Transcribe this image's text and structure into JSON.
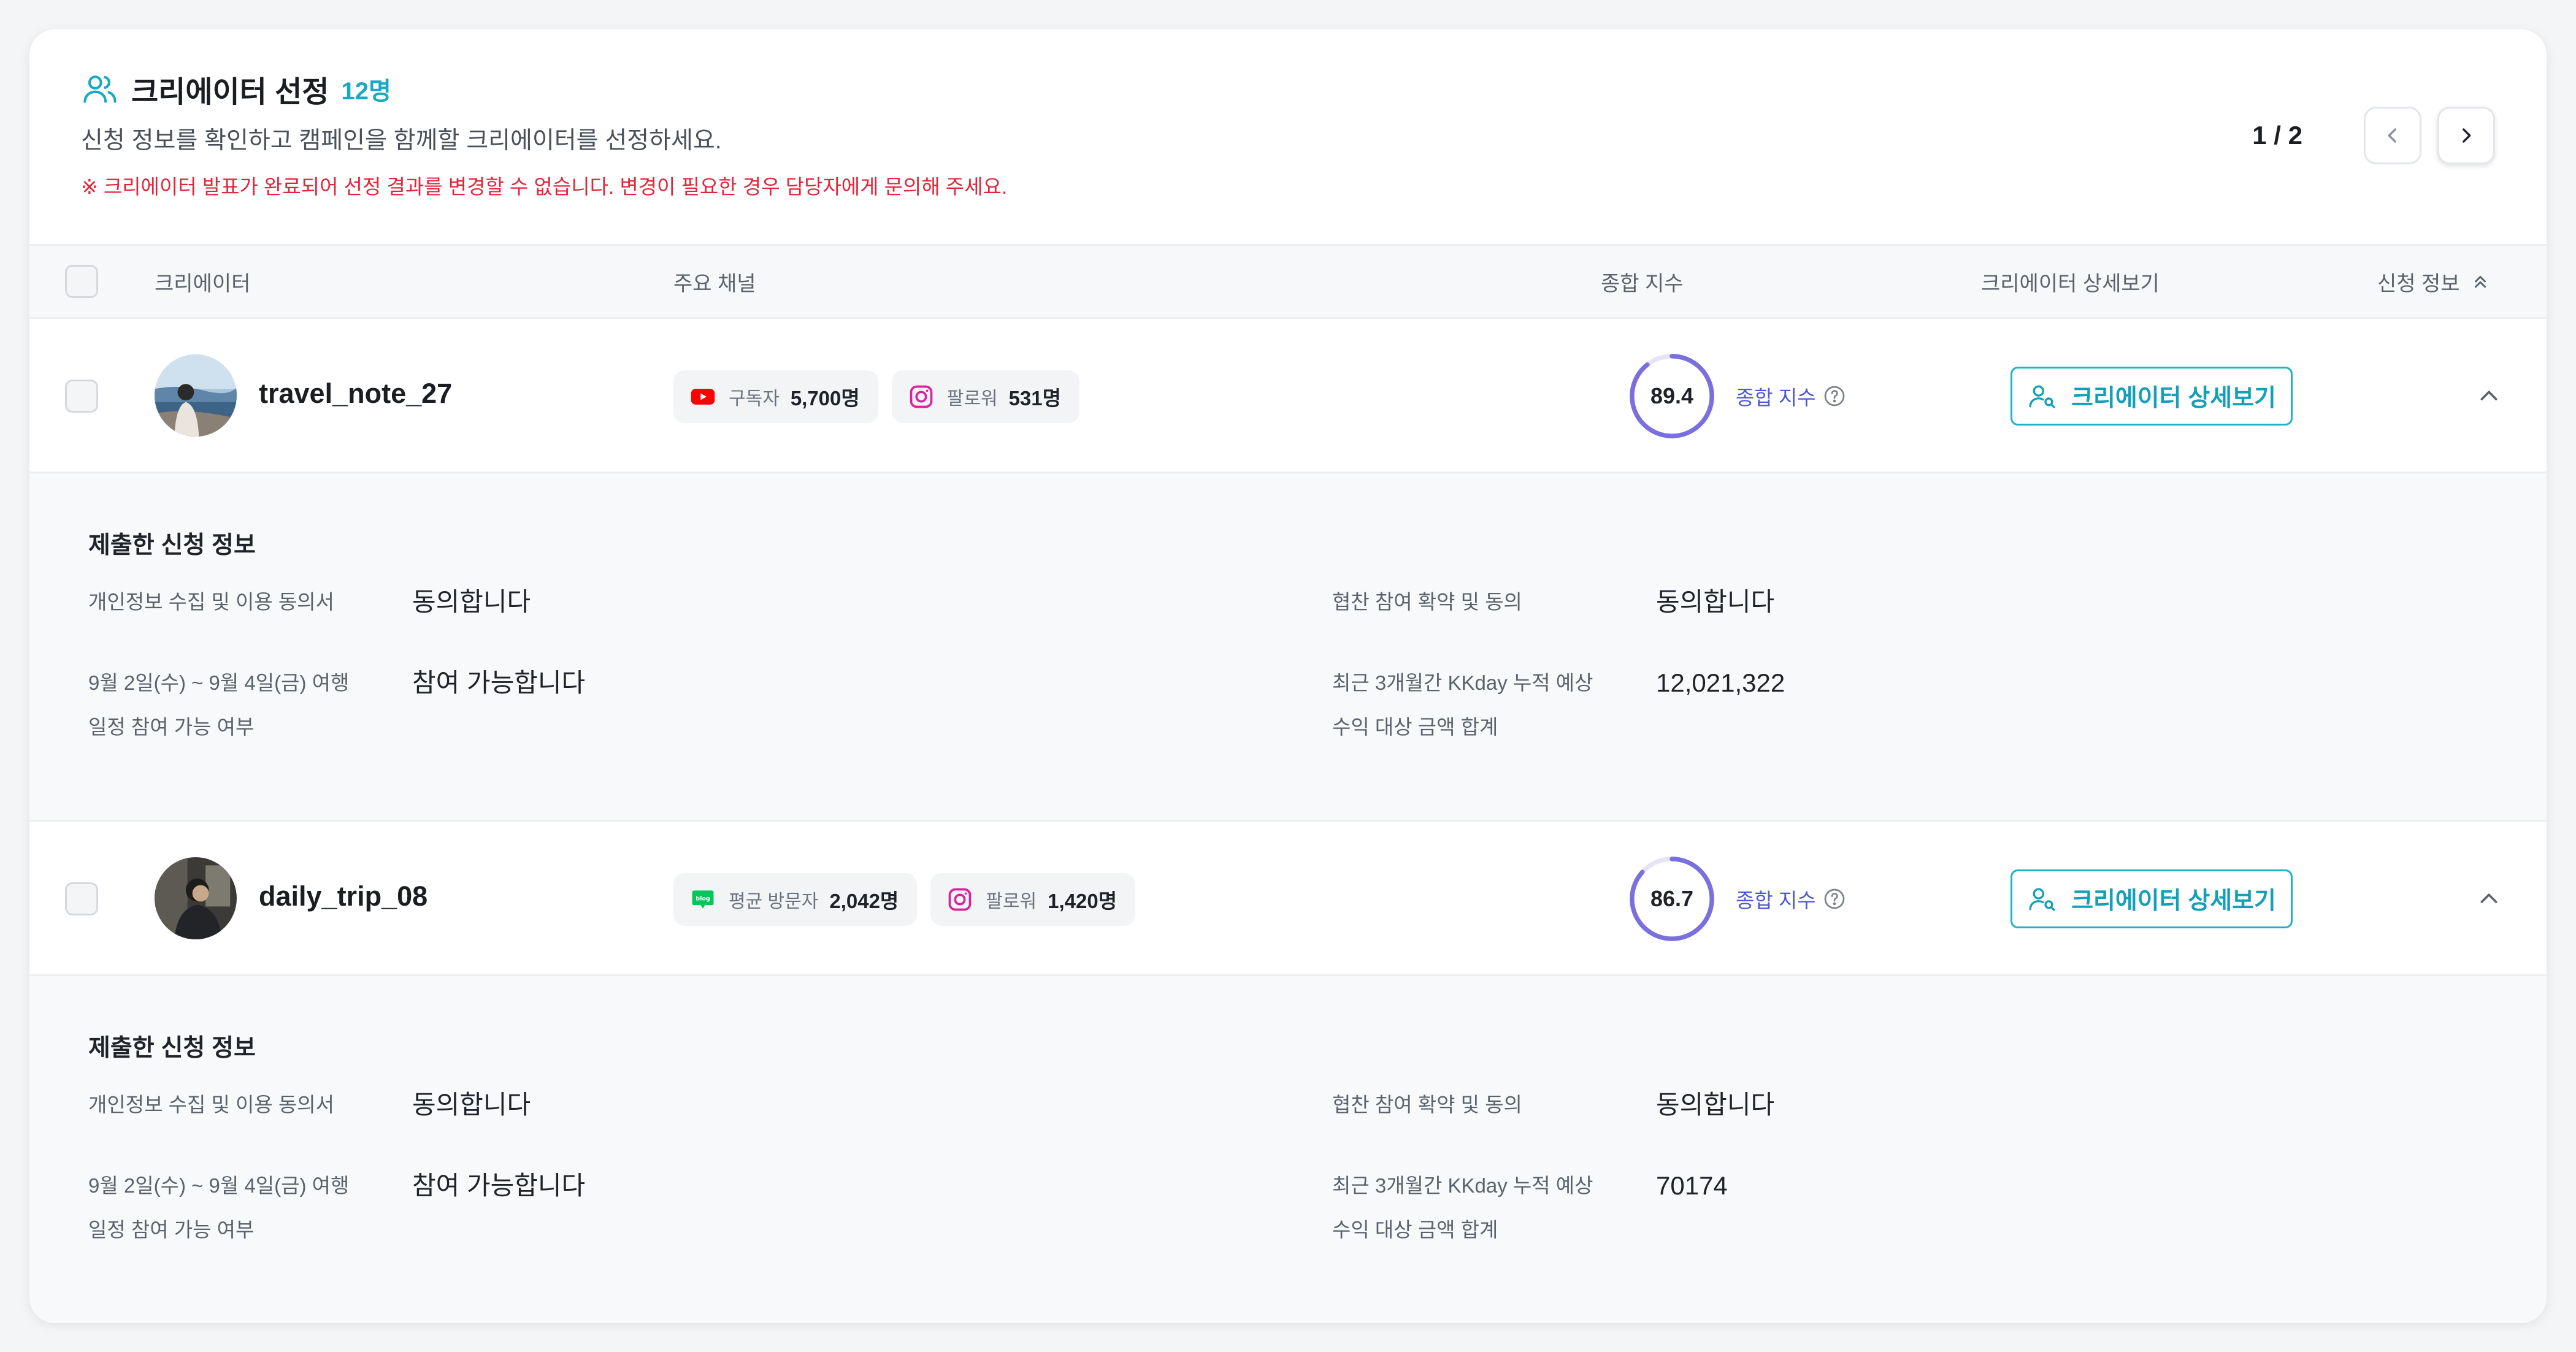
{
  "header": {
    "title": "크리에이터 선정",
    "count": "12명",
    "subtitle": "신청 정보를 확인하고 캠페인을 함께할 크리에이터를 선정하세요.",
    "notice": "※ 크리에이터 발표가 완료되어 선정 결과를 변경할 수 없습니다. 변경이 필요한 경우 담당자에게 문의해 주세요.",
    "page": "1 / 2"
  },
  "columns": {
    "creator": "크리에이터",
    "channel": "주요 채널",
    "score": "종합 지수",
    "detail": "크리에이터 상세보기",
    "apply": "신청 정보"
  },
  "rows": [
    {
      "handle": "travel_note_27",
      "channels": [
        {
          "icon": "youtube-icon",
          "label": "구독자",
          "value": "5,700명"
        },
        {
          "icon": "instagram-icon",
          "label": "팔로워",
          "value": "531명"
        }
      ],
      "score": 89.4,
      "score_text": "89.4",
      "score_label": "종합 지수",
      "detail_button": "크리에이터 상세보기",
      "panel": {
        "title": "제출한 신청 정보",
        "f1_label": "개인정보 수집 및 이용 동의서",
        "f1_value": "동의합니다",
        "f2_label": "협찬 참여 확약 및 동의",
        "f2_value": "동의합니다",
        "f3_label_1": "9월 2일(수) ~ 9월 4일(금) 여행",
        "f3_label_2": "일정 참여 가능 여부",
        "f3_value": "참여 가능합니다",
        "f4_label_1": "최근 3개월간 KKday 누적 예상",
        "f4_label_2": "수익 대상 금액 합계",
        "f4_value": "12,021,322"
      }
    },
    {
      "handle": "daily_trip_08",
      "channels": [
        {
          "icon": "naver-blog-icon",
          "label": "평균 방문자",
          "value": "2,042명"
        },
        {
          "icon": "instagram-icon",
          "label": "팔로워",
          "value": "1,420명"
        }
      ],
      "score": 86.7,
      "score_text": "86.7",
      "score_label": "종합 지수",
      "detail_button": "크리에이터 상세보기",
      "panel": {
        "title": "제출한 신청 정보",
        "f1_label": "개인정보 수집 및 이용 동의서",
        "f1_value": "동의합니다",
        "f2_label": "협찬 참여 확약 및 동의",
        "f2_value": "동의합니다",
        "f3_label_1": "9월 2일(수) ~ 9월 4일(금) 여행",
        "f3_label_2": "일정 참여 가능 여부",
        "f3_value": "참여 가능합니다",
        "f4_label_1": "최근 3개월간 KKday 누적 예상",
        "f4_label_2": "수익 대상 금액 합계",
        "f4_value": "70174"
      }
    }
  ],
  "colors": {
    "accent": "#18a9c4",
    "score_ring": "#7b6fe0",
    "score_label": "#4e57d4",
    "notice": "#e0263a"
  }
}
